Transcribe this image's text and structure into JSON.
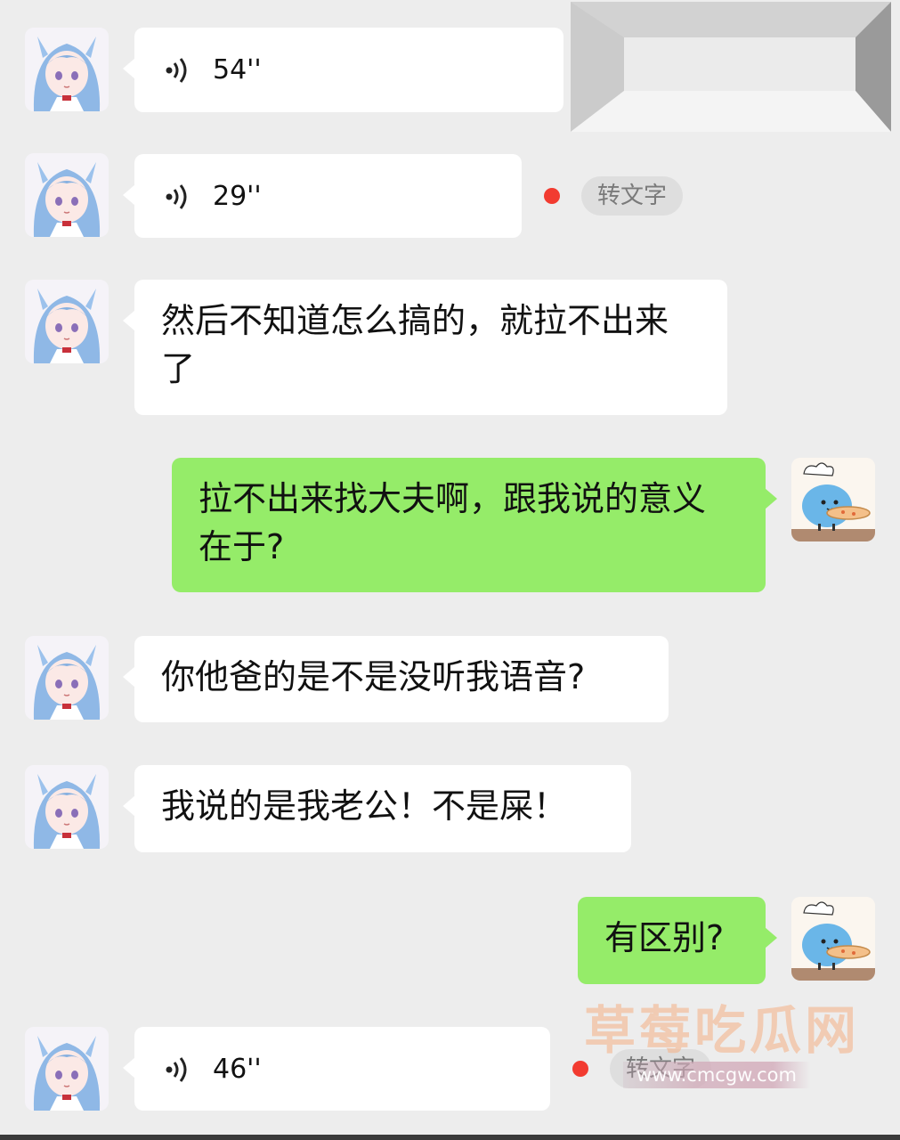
{
  "messages": [
    {
      "side": "left",
      "type": "voice",
      "duration": "54''"
    },
    {
      "side": "left",
      "type": "voice",
      "duration": "29''",
      "unread": true,
      "to_text": "转文字"
    },
    {
      "side": "left",
      "type": "text",
      "text": "然后不知道怎么搞的，就拉不出来了"
    },
    {
      "side": "right",
      "type": "text",
      "text": "拉不出来找大夫啊，跟我说的意义在于?"
    },
    {
      "side": "left",
      "type": "text",
      "text": "你他爸的是不是没听我语音?"
    },
    {
      "side": "left",
      "type": "text",
      "text": "我说的是我老公！不是屎！"
    },
    {
      "side": "right",
      "type": "text",
      "text": "有区别?"
    },
    {
      "side": "left",
      "type": "voice",
      "duration": "46''",
      "unread": true,
      "to_text": "转文字"
    }
  ],
  "watermark": {
    "title": "草莓吃瓜网",
    "url": "www.cmcgw.com"
  },
  "colors": {
    "background": "#ededed",
    "incoming_bubble": "#ffffff",
    "outgoing_bubble": "#95ec69",
    "unread_dot": "#f23b30"
  },
  "icons": {
    "voice": "voice-wave-icon",
    "avatar_left": "anime-girl-avatar",
    "avatar_right": "cartoon-chef-cat-avatar"
  }
}
